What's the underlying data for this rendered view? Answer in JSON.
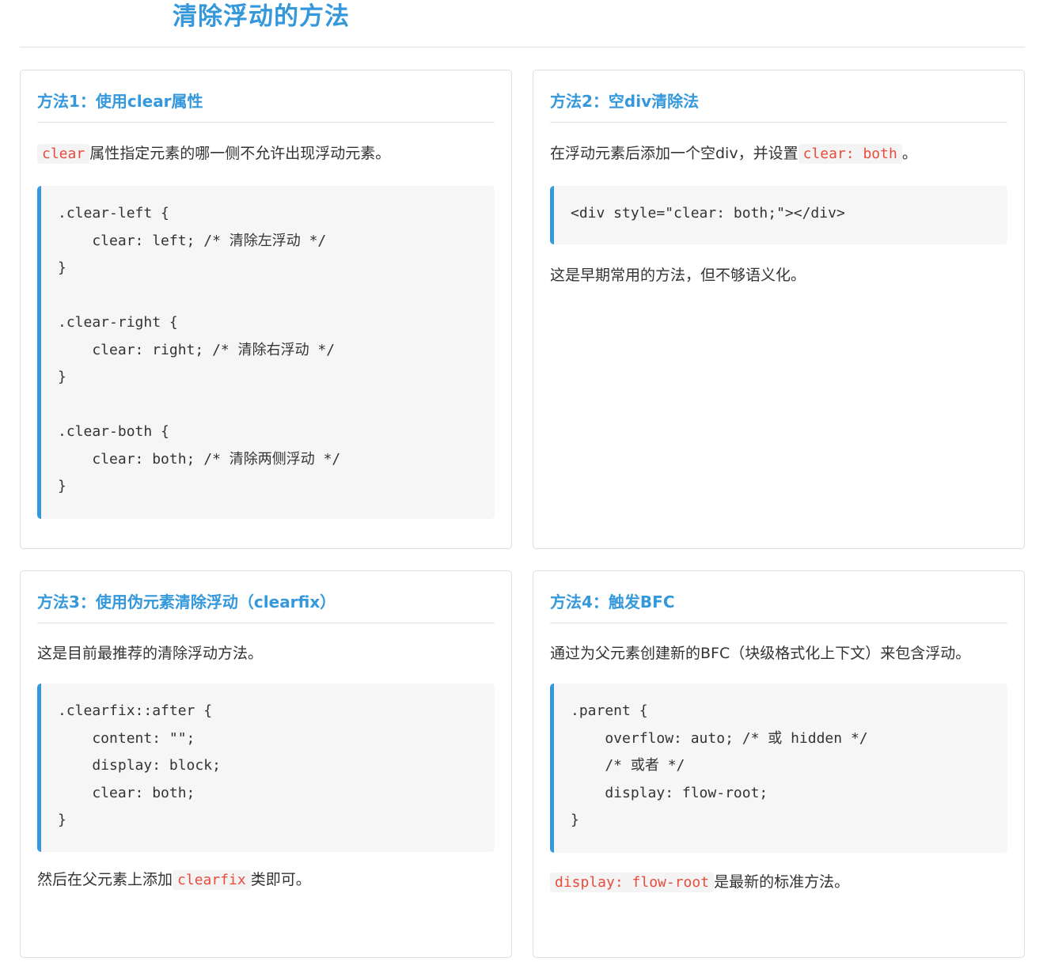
{
  "title": "清除浮动的方法",
  "cards": [
    {
      "heading": "方法1：使用clear属性",
      "intro_code": "clear",
      "intro_text": "属性指定元素的哪一侧不允许出现浮动元素。",
      "code": ".clear-left {\n    clear: left; /* 清除左浮动 */\n}\n\n.clear-right {\n    clear: right; /* 清除右浮动 */\n}\n\n.clear-both {\n    clear: both; /* 清除两侧浮动 */\n}"
    },
    {
      "heading": "方法2：空div清除法",
      "intro_text": "在浮动元素后添加一个空div，并设置",
      "intro_code": "clear: both",
      "intro_suffix": "。",
      "code": "<div style=\"clear: both;\"></div>",
      "outro_text": "这是早期常用的方法，但不够语义化。"
    },
    {
      "heading": "方法3：使用伪元素清除浮动（clearfix）",
      "intro_text": "这是目前最推荐的清除浮动方法。",
      "code": ".clearfix::after {\n    content: \"\";\n    display: block;\n    clear: both;\n}",
      "outro_text": "然后在父元素上添加",
      "outro_code": "clearfix",
      "outro_suffix": "类即可。"
    },
    {
      "heading": "方法4：触发BFC",
      "intro_text": "通过为父元素创建新的BFC（块级格式化上下文）来包含浮动。",
      "code": ".parent {\n    overflow: auto; /* 或 hidden */\n    /* 或者 */\n    display: flow-root;\n}",
      "outro_code": "display: flow-root",
      "outro_text": "是最新的标准方法。"
    }
  ],
  "colors": {
    "accent": "#3498db",
    "inline_code": "#e74c3c",
    "code_bg": "#f6f6f6",
    "text": "#333333"
  }
}
